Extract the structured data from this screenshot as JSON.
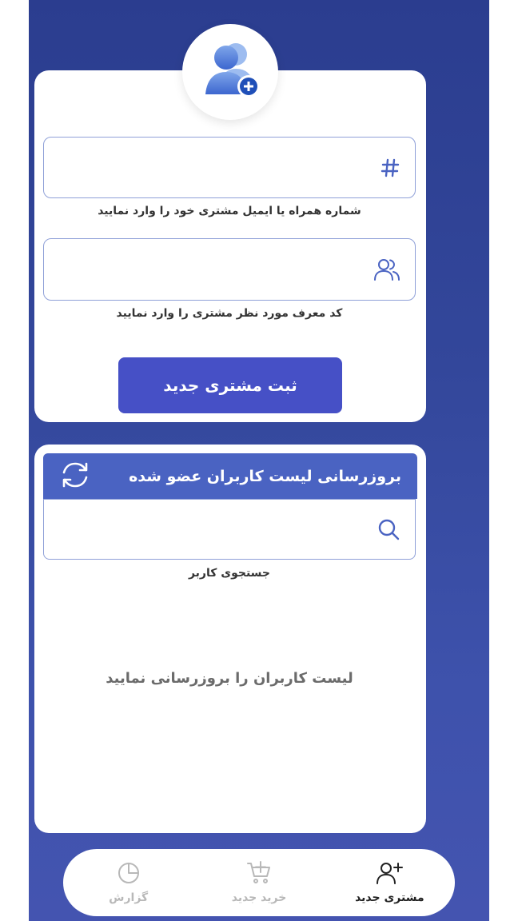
{
  "form": {
    "phone_field": {
      "value": "",
      "icon": "hash-icon",
      "hint": "شماره همراه یا ایمیل مشتری خود را وارد نمایید"
    },
    "referrer_field": {
      "value": "",
      "icon": "users-icon",
      "hint": "کد معرف مورد نظر مشتری را وارد نمایید"
    },
    "submit_label": "ثبت مشتری جدید"
  },
  "members": {
    "refresh_title": "بروزرسانی لیست کاربران عضو شده",
    "search": {
      "value": "",
      "icon": "search-icon",
      "hint": "جستجوی کاربر"
    },
    "empty_message": "لیست کاربران را بروزرسانی نمایید"
  },
  "bottom_nav": {
    "items": [
      {
        "label": "مشتری جدید",
        "icon": "user-plus-icon",
        "active": true
      },
      {
        "label": "خرید جدید",
        "icon": "cart-plus-icon",
        "active": false
      },
      {
        "label": "گزارش",
        "icon": "pie-chart-icon",
        "active": false
      }
    ]
  },
  "colors": {
    "background": "#33479b",
    "primary_button": "#4650c6",
    "refresh_bar": "#4a63c2",
    "field_border": "#8fa0d8",
    "icon_blue": "#4a63c2"
  }
}
